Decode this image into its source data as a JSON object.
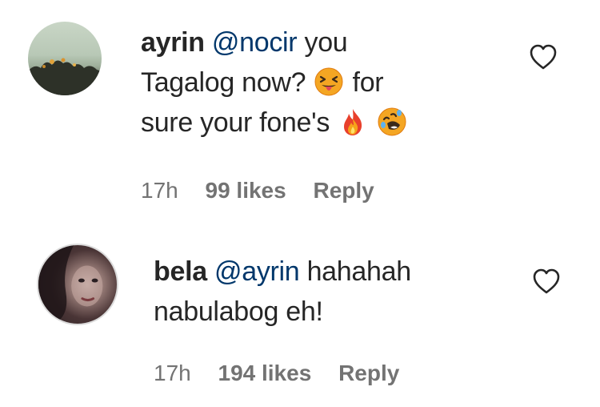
{
  "comments": [
    {
      "avatar": "avatar-landscape-trees",
      "username": "ayrin",
      "mention": "@nocir",
      "text_lines": [
        "you",
        "Tagalog now?",
        "for",
        "sure your fone's"
      ],
      "emojis": [
        "squinting-face-with-tongue-icon",
        "fire-icon",
        "rolling-on-floor-laughing-icon"
      ],
      "time": "17h",
      "likes": "99 likes",
      "reply": "Reply",
      "liked": false
    },
    {
      "avatar": "avatar-portrait",
      "username": "bela",
      "mention": "@ayrin",
      "text_lines": [
        "hahahah",
        "nabulabog eh!"
      ],
      "time": "17h",
      "likes": "194 likes",
      "reply": "Reply",
      "liked": false
    }
  ],
  "colors": {
    "text": "#262626",
    "mention": "#00376b",
    "meta": "#737373",
    "background": "#ffffff"
  }
}
